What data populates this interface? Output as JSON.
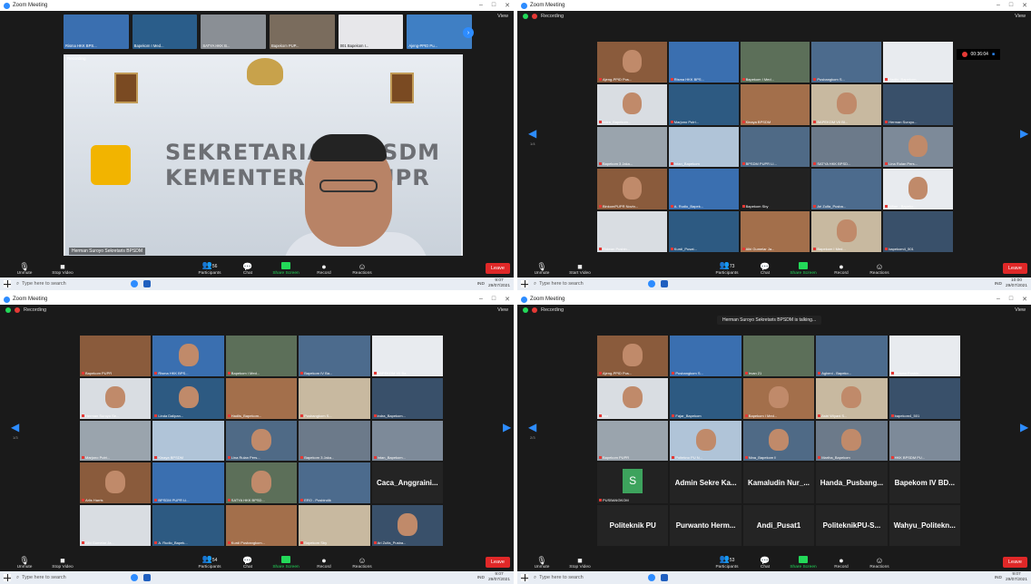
{
  "app": {
    "title": "Zoom Meeting",
    "view": "View",
    "recording": "Recording",
    "leave": "Leave"
  },
  "toolbar": {
    "unmute": "Unmute",
    "stop_video": "Stop Video",
    "start_video": "Start Video",
    "participants": "Participants",
    "chat": "Chat",
    "share": "Share Screen",
    "record": "Record",
    "reactions": "Reactions"
  },
  "taskbar": {
    "search": "Type here to search",
    "lang": "IND",
    "date": "29/07/2021",
    "times": [
      "9:07",
      "10:00",
      "9:07",
      "9:07"
    ]
  },
  "counts": {
    "tl": "56",
    "tr": "73",
    "bl": "54",
    "br": "53"
  },
  "speaker": {
    "name": "Herman Suroyo Sekretaris BPSDM",
    "wall_line1": "SEKRETARIAT BPSDM",
    "wall_line2": "KEMENTERIAN PUPR"
  },
  "strip": [
    "Risma HKK BPS...",
    "Bapekom I Med...",
    "SATYA HKK B...",
    "Bapekom PUP...",
    "001 Bapekom I...",
    "Ajeng-PPID Pu..."
  ],
  "tr_timer": "00:36:04",
  "tr_tiles": [
    "Ajeng-PPID Pus...",
    "Risma HKK BPS...",
    "Bapekom I Med...",
    "Pusbangkom S...",
    "Hadlis_Bapekom...",
    "indra_Bapekom...",
    "Marjono Putri...",
    "Kinaya BPSDM",
    "BAPEKOM VII Bl...",
    "Herman Suroyo...",
    "Bapekom 3 Jaka...",
    "Intan_Bapekom",
    "BPSDM PUPR LI...",
    "SATYA HKK BPSD...",
    "Lina Rulan Pers...",
    "BinkomPUPR Novin...",
    "A. Rudio_Bapek...",
    "Bapekom Sby",
    "Ari Zulfa_Pusba...",
    "Alfian - Bapeko...",
    "Ridwan Pusbin...",
    "Kurdi_Pusat...",
    "Albi Gumelar Ja...",
    "Bapekom I Med...",
    "bapekom4_501"
  ],
  "bl_tiles": [
    "Bapekom PUPR",
    "Risma HKK BPS...",
    "Bapekom I Med...",
    "Bapekom IV Ba...",
    "BAPEKOM VII Ba...",
    "Herman Suroyo Se...",
    "Linda Dalipan...",
    "Hadlis_Bapekom...",
    "Pusbangkom S...",
    "indra_Bapekom...",
    "Marjono Putri...",
    "Kinaya BPSDM",
    "Lina Rulan Pers...",
    "Bapekom 3 Jaka...",
    "Intan_Bapekom...",
    "Arlis Harris",
    "BPSDM PUPR LI...",
    "SATYA HKK BPSD...",
    "ERO - Pusbindik",
    "Caca_Anggraini...",
    "Albi Gumelar Ja...",
    "A. Rudio_Bapek...",
    "Kurdi Pusbangkom...",
    "Bapekom Sby",
    "Ari Zulfa_Pusba..."
  ],
  "br_talking": "Herman Suroyo Sekretaris BPSDM is talking...",
  "br_tiles": [
    "Ajeng-PPID Pus...",
    "Pusbangkom S...",
    "Irvan 21",
    "Agheni - Bapeko...",
    "Ridwan Pusbin...",
    "tina",
    "Fajar_Bapekom",
    "Bapekom I Med...",
    "Astri Wiyani S...",
    "bapekom4_501",
    "Bapekom PUPR",
    "Poltekno PU N...",
    "Nina_Bapekom II",
    "Martha_Bapekom",
    "HKK BPSDM PU...",
    "PUSBANGKOM",
    "Admin Sekre Ka...",
    "Kamaludin Nur_...",
    "Handa_Pusbang...",
    "Bapekom IV BD...",
    "Politeknik PU",
    "Purwanto Herm...",
    "Andi_Pusat1",
    "PoliteknikPU-S...",
    "Wahyu_Politekn..."
  ],
  "pages": {
    "tr": "1/4",
    "bl": "1/3",
    "br": "2/3"
  },
  "colors": {
    "zoom_blue": "#2d8cff",
    "leave_red": "#e02828",
    "share_green": "#23d959"
  }
}
